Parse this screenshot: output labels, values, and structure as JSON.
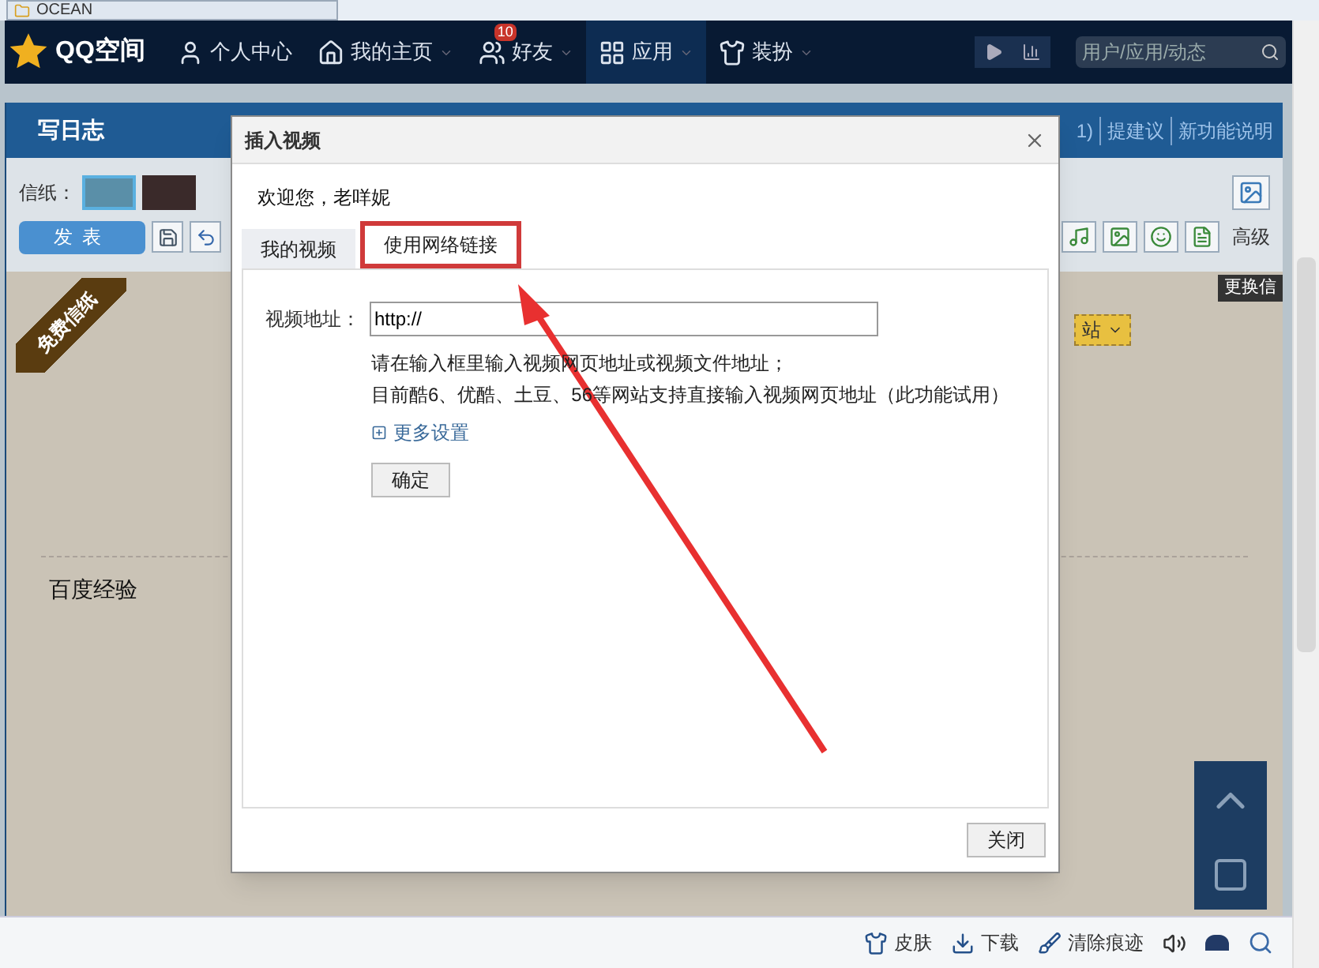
{
  "browser_tab": {
    "title": "OCEAN"
  },
  "navbar": {
    "logo": "QQ空间",
    "items": [
      {
        "label": "个人中心",
        "dropdown": false,
        "selected": false
      },
      {
        "label": "我的主页",
        "dropdown": true,
        "selected": false
      },
      {
        "label": "好友",
        "badge": "10",
        "dropdown": true,
        "selected": false
      },
      {
        "label": "应用",
        "dropdown": true,
        "selected": true
      },
      {
        "label": "装扮",
        "dropdown": true,
        "selected": false
      }
    ],
    "search": {
      "placeholder": "用户/应用/动态"
    }
  },
  "editor": {
    "title": "写日志",
    "links": [
      "1)",
      "提建议",
      "新功能说明"
    ],
    "stationery_label": "信纸：",
    "publish_button": "发表",
    "advanced": "高级",
    "change_label": "更换信",
    "ribbon": "免费信纸",
    "partial_button": "站",
    "body_text": "百度经验"
  },
  "dialog": {
    "title": "插入视频",
    "welcome": "欢迎您，老咩妮",
    "tabs": [
      {
        "label": "我的视频",
        "selected": false
      },
      {
        "label": "使用网络链接",
        "selected": true
      }
    ],
    "url_label": "视频地址：",
    "url_value": "http://",
    "hints": [
      "请在输入框里输入视频网页地址或视频文件地址；",
      "目前酷6、优酷、土豆、56等网站支持直接输入视频网页地址（此功能试用）"
    ],
    "more_settings": "更多设置",
    "confirm": "确定",
    "close": "关闭"
  },
  "status_bar": {
    "items": [
      {
        "label": "皮肤"
      },
      {
        "label": "下载"
      },
      {
        "label": "清除痕迹"
      }
    ]
  }
}
